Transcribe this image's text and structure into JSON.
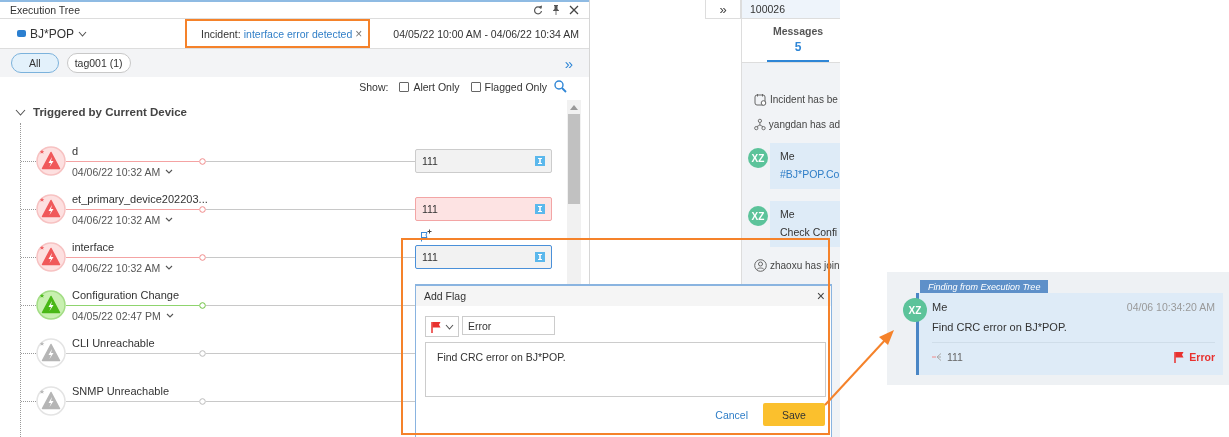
{
  "panel": {
    "title": "Execution Tree",
    "device": "BJ*POP",
    "incident_label": "Incident:",
    "incident_value": "interface error detected",
    "incident_close": "×",
    "time_range": "04/05/22 10:00 AM - 04/06/22 10:34 AM",
    "more": "»"
  },
  "tags": [
    {
      "label": "All",
      "selected": true
    },
    {
      "label": "tag001 (1)",
      "selected": false
    }
  ],
  "show": {
    "label": "Show:",
    "options": [
      {
        "label": "Alert Only",
        "checked": false
      },
      {
        "label": "Flagged Only",
        "checked": false
      }
    ]
  },
  "tree": {
    "label": "Triggered by Current Device",
    "expanded": true,
    "children": [
      {
        "name": "d",
        "time": "04/06/22 10:32 AM",
        "kind": "alert",
        "box": {
          "label": "111",
          "kind": "plain",
          "selected": false
        }
      },
      {
        "name": "et_primary_device202203...",
        "time": "04/06/22 10:32 AM",
        "kind": "alert",
        "box": {
          "label": "111",
          "kind": "alert",
          "selected": false
        }
      },
      {
        "name": "interface",
        "time": "04/06/22 10:32 AM",
        "kind": "alert",
        "box": {
          "label": "111",
          "kind": "plain",
          "selected": true
        }
      },
      {
        "name": "Configuration Change",
        "time": "04/05/22 02:47 PM",
        "kind": "change"
      },
      {
        "name": "CLI Unreachable",
        "kind": "inactive"
      },
      {
        "name": "SNMP Unreachable",
        "kind": "inactive"
      }
    ]
  },
  "add_flag": {
    "title": "Add Flag",
    "close": "×",
    "flag_type": "Error",
    "note": "Find CRC error on BJ*POP.",
    "cancel": "Cancel",
    "save": "Save"
  },
  "side": {
    "expand": "»",
    "id": "100026",
    "tab": {
      "label": "Messages",
      "count": "5",
      "selected": true
    },
    "feed": [
      {
        "kind": "event",
        "text": "Incident has be"
      },
      {
        "kind": "event",
        "text": "yangdan has ad"
      },
      {
        "kind": "message",
        "avatar": "XZ",
        "author": "Me",
        "text": "#BJ*POP.Co",
        "link": true
      },
      {
        "kind": "message",
        "avatar": "XZ",
        "author": "Me",
        "text": "Check Confi",
        "link": false
      },
      {
        "kind": "event",
        "text": "zhaoxu has join"
      }
    ]
  },
  "finding": {
    "tag": "Finding from Execution Tree",
    "avatar": "XZ",
    "author": "Me",
    "time": "04/06 10:34:20 AM",
    "text": "Find CRC error on BJ*POP.",
    "node": "111",
    "flag": "Error"
  }
}
